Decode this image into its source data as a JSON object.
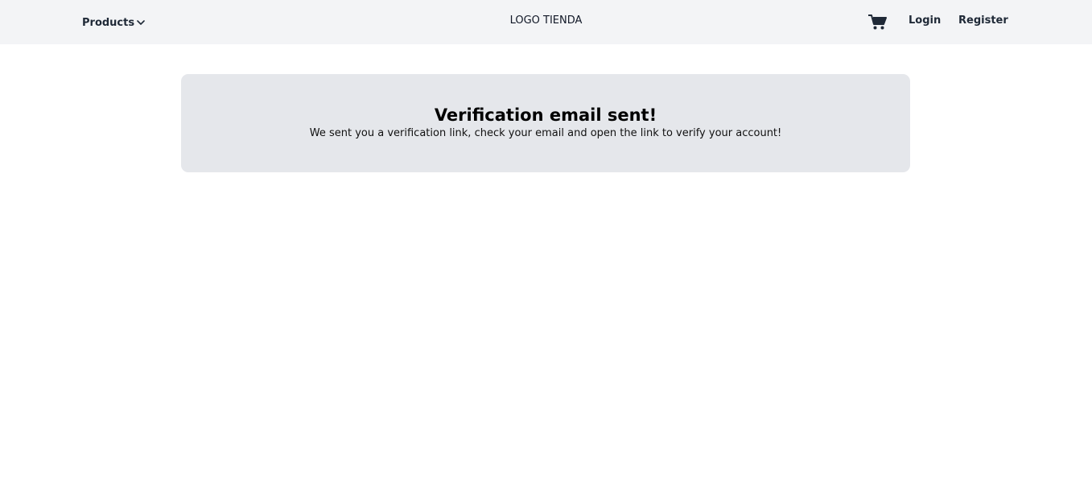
{
  "nav": {
    "products_label": "Products",
    "products_icon": "chevron-down-icon",
    "logo_text": "LOGO TIENDA",
    "cart_icon": "cart-icon",
    "login_label": "Login",
    "register_label": "Register",
    "background_color": "#f3f4f6"
  },
  "message": {
    "title": "Verification email sent!",
    "body": "We sent you a verification link, check your email and open the link to verify your account!",
    "background_color": "#e5e7eb"
  }
}
